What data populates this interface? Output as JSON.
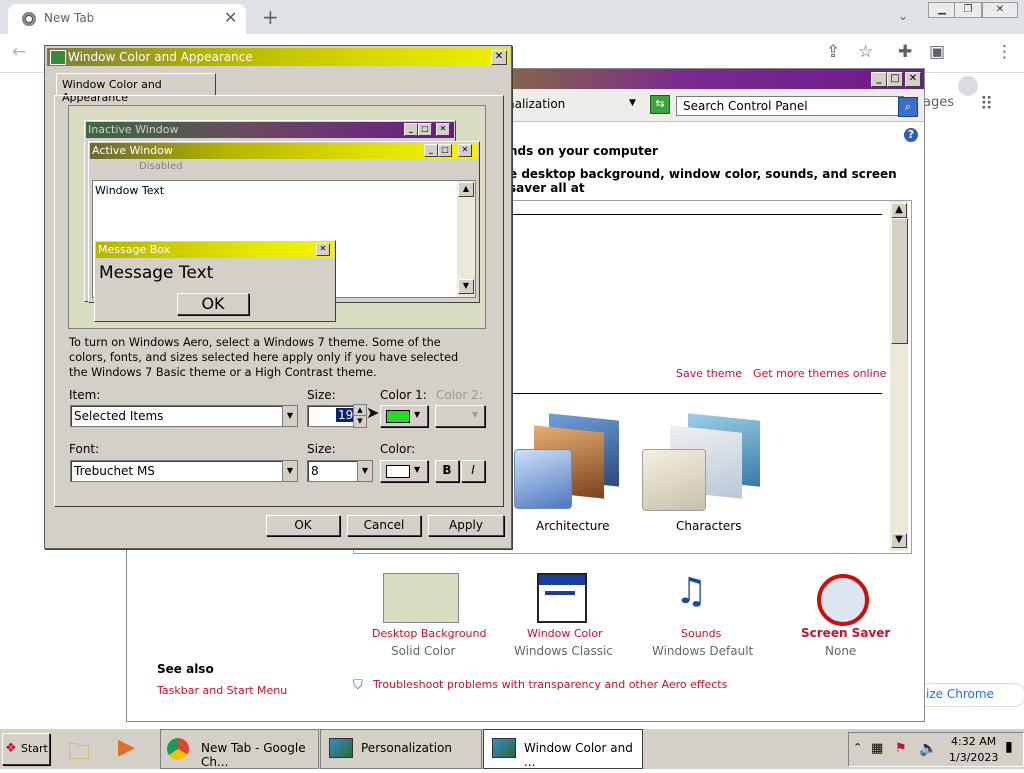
{
  "chrome": {
    "tab_title": "New Tab",
    "right_partial_labels": [
      "ages",
      "ize Chrome"
    ]
  },
  "control_panel": {
    "address": "nalization",
    "search_placeholder": "Search Control Panel",
    "heading": "nds on your computer",
    "subheading": "e desktop background, window color, sounds, and screen saver all at",
    "save_theme": "Save theme",
    "get_more_themes": "Get more themes online",
    "themes": [
      {
        "label": "Architecture"
      },
      {
        "label": "Characters"
      }
    ],
    "bottom": [
      {
        "title": "Desktop Background",
        "value": "Solid Color"
      },
      {
        "title": "Window Color",
        "value": "Windows Classic"
      },
      {
        "title": "Sounds",
        "value": "Windows Default"
      },
      {
        "title": "Screen Saver",
        "value": "None"
      }
    ],
    "see_also": "See also",
    "taskbar_link": "Taskbar and Start Menu",
    "troubleshoot": "Troubleshoot problems with transparency and other Aero effects"
  },
  "dialog": {
    "title": "Window Color and Appearance",
    "tab": "Window Color and Appearance",
    "preview": {
      "inactive_title": "Inactive Window",
      "active_title": "Active Window",
      "disabled": "Disabled",
      "window_text": "Window Text",
      "msgbox_title": "Message Box",
      "msgbox_text": "Message Text",
      "ok": "OK"
    },
    "info": "To turn on Windows Aero, select a Windows 7 theme.  Some of the colors, fonts, and sizes selected here apply only if you have selected the Windows 7 Basic theme or a High Contrast theme.",
    "item_label": "Item:",
    "item_value": "Selected Items",
    "size_label": "Size:",
    "size_value": "19",
    "color1_label": "Color 1:",
    "color1_hex": "#22dd22",
    "color2_label": "Color 2:",
    "font_label": "Font:",
    "font_value": "Trebuchet MS",
    "font_size_label": "Size:",
    "font_size_value": "8",
    "font_color_label": "Color:",
    "bold": "B",
    "italic": "I",
    "ok": "OK",
    "cancel": "Cancel",
    "apply": "Apply"
  },
  "taskbar": {
    "start": "Start",
    "tasks": [
      "New Tab - Google Ch...",
      "Personalization",
      "Window Color and ..."
    ],
    "time": "4:32 AM",
    "date": "1/3/2023"
  }
}
